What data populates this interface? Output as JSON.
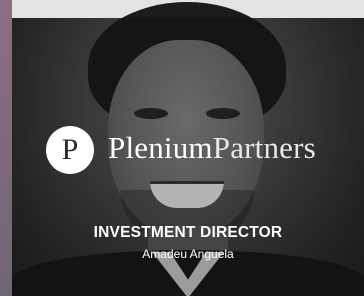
{
  "logo": {
    "glyph": "P",
    "brand_first": "Plenium",
    "brand_second": "Partners"
  },
  "caption": {
    "role": "INVESTMENT DIRECTOR",
    "name": "Amadeu Anguela"
  }
}
